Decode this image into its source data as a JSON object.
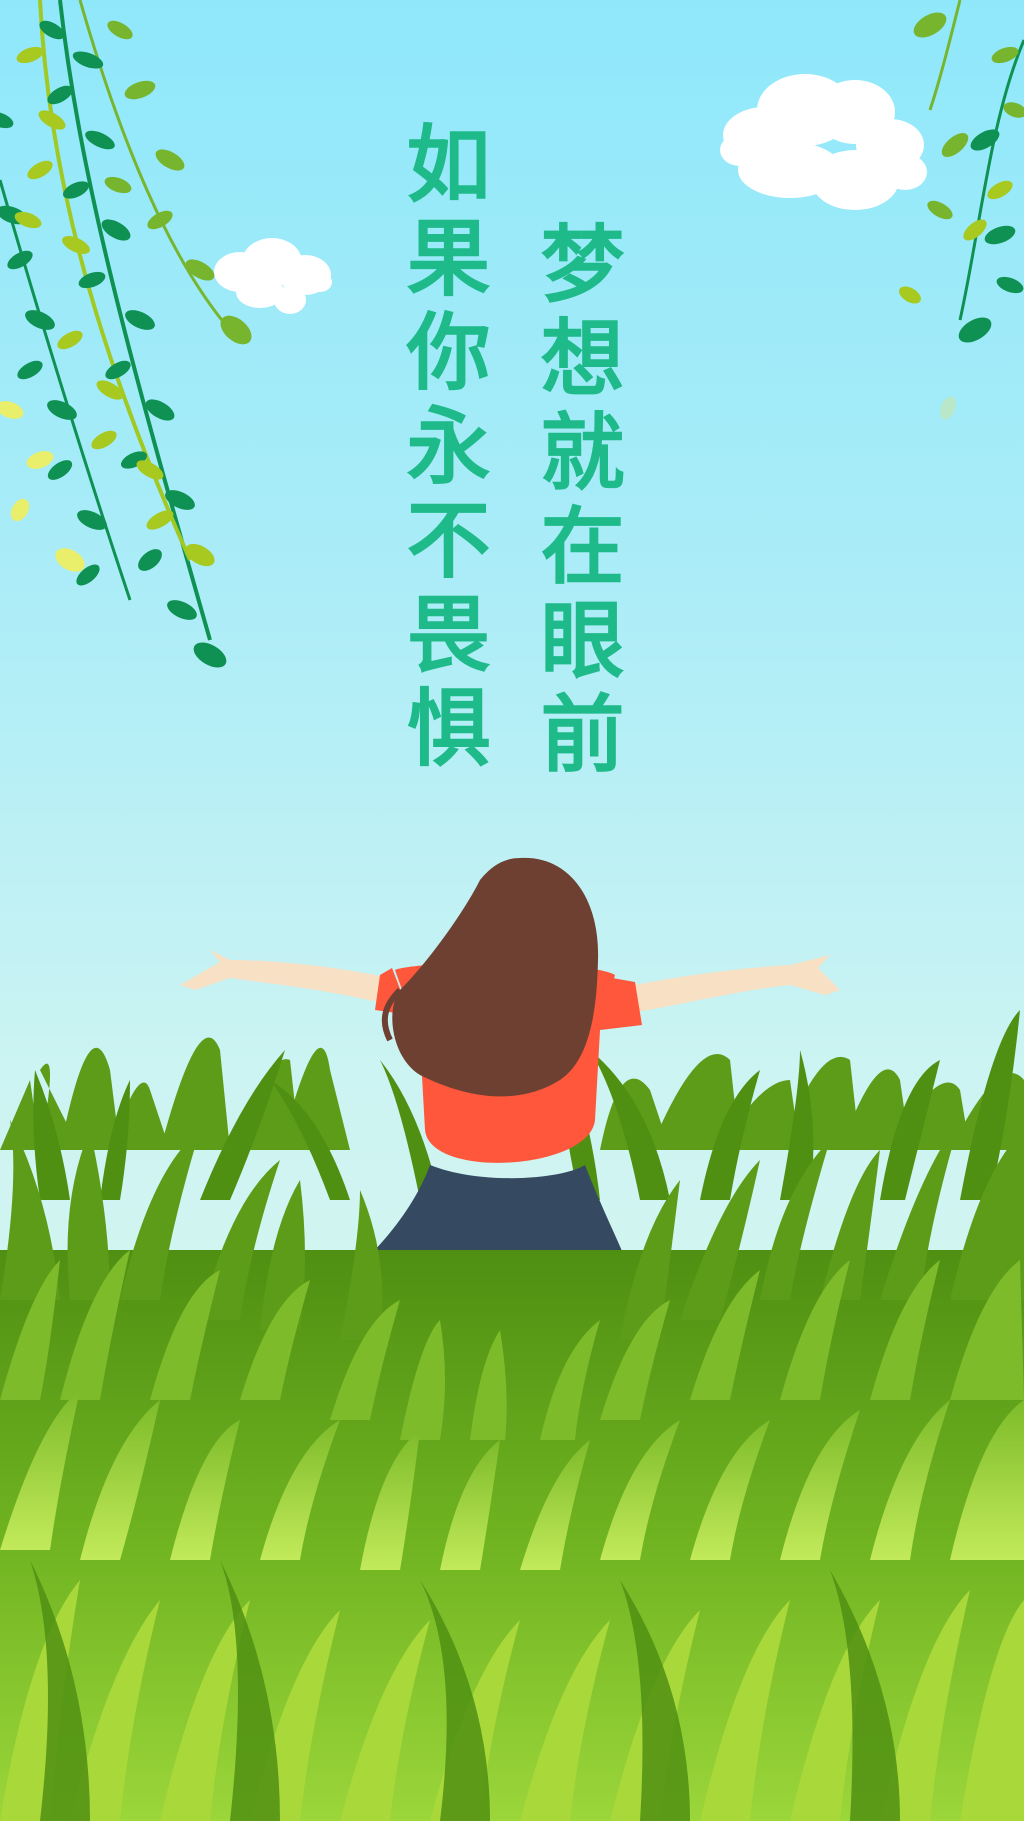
{
  "poem": {
    "line1": "如果你永不畏惧",
    "line2": "梦想就在眼前"
  },
  "scene": {
    "subject": "girl-with-open-arms",
    "setting": "grass-field",
    "elements": [
      "willow-branches",
      "clouds",
      "tall-grass"
    ]
  },
  "colors": {
    "sky_top": "#8fe8fa",
    "sky_bottom": "#dff8ee",
    "text": "#1fba8a",
    "hair": "#6e4032",
    "shirt": "#ff573b",
    "skirt": "#354a61",
    "skin": "#f7e0c4",
    "grass_dark": "#5c9c18",
    "grass_light": "#a8d83a"
  }
}
